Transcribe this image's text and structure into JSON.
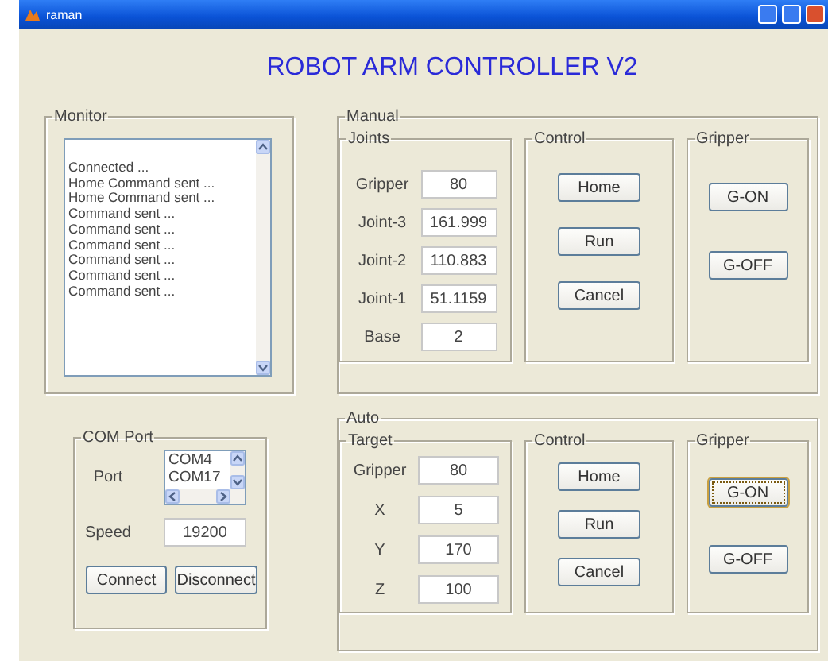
{
  "window": {
    "title": "raman"
  },
  "heading": "ROBOT ARM CONTROLLER V2",
  "monitor": {
    "title": "Monitor",
    "lines": [
      "Connected ...",
      "Home Command sent ...",
      "Home Command sent ...",
      "Command sent ...",
      "Command sent ...",
      "Command sent ...",
      "Command sent ...",
      "Command sent ...",
      "Command sent ..."
    ]
  },
  "com_port": {
    "title": "COM Port",
    "port_label": "Port",
    "ports": [
      "COM4",
      "COM17"
    ],
    "speed_label": "Speed",
    "speed": "19200",
    "buttons": [
      "Connect",
      "Disconnect"
    ]
  },
  "manual": {
    "title": "Manual",
    "inputs": {
      "title": "Joints",
      "fields": [
        {
          "label": "Gripper",
          "value": "80"
        },
        {
          "label": "Joint-3",
          "value": "161.999"
        },
        {
          "label": "Joint-2",
          "value": "110.883"
        },
        {
          "label": "Joint-1",
          "value": "51.1159"
        },
        {
          "label": "Base",
          "value": "2"
        }
      ]
    },
    "control": {
      "title": "Control",
      "buttons": [
        "Home",
        "Run",
        "Cancel"
      ]
    },
    "gripper": {
      "title": "Gripper",
      "buttons": [
        {
          "label": "G-ON",
          "focused": false
        },
        {
          "label": "G-OFF",
          "focused": false
        }
      ]
    }
  },
  "auto": {
    "title": "Auto",
    "inputs": {
      "title": "Target",
      "fields": [
        {
          "label": "Gripper",
          "value": "80"
        },
        {
          "label": "X",
          "value": "5"
        },
        {
          "label": "Y",
          "value": "170"
        },
        {
          "label": "Z",
          "value": "100"
        }
      ]
    },
    "control": {
      "title": "Control",
      "buttons": [
        "Home",
        "Run",
        "Cancel"
      ]
    },
    "gripper": {
      "title": "Gripper",
      "buttons": [
        {
          "label": "G-ON",
          "focused": true
        },
        {
          "label": "G-OFF",
          "focused": false
        }
      ]
    }
  }
}
